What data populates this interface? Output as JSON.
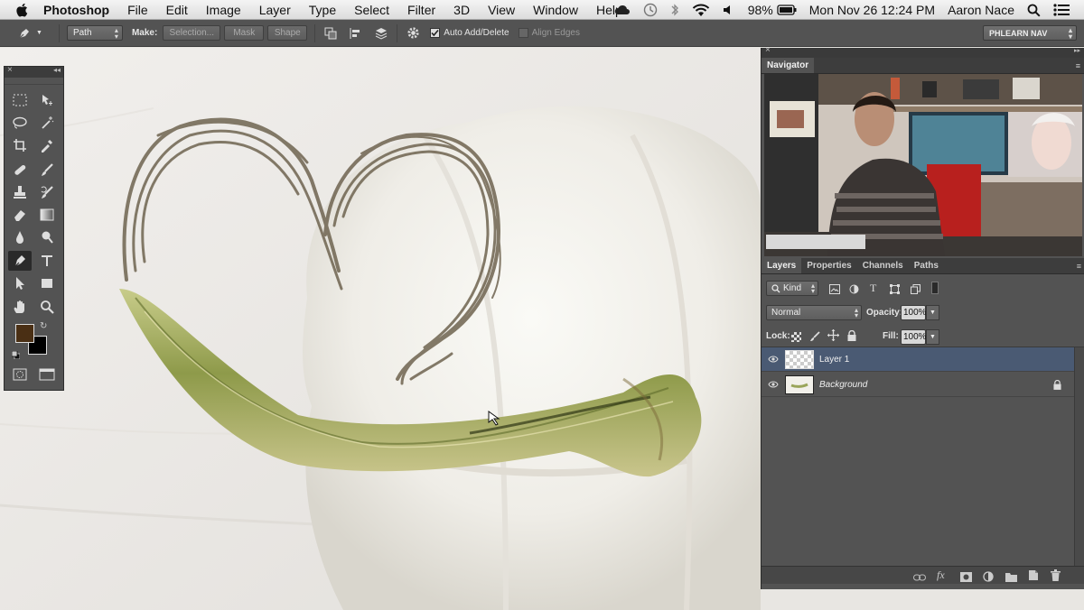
{
  "menubar": {
    "app_name": "Photoshop",
    "items": [
      "File",
      "Edit",
      "Image",
      "Layer",
      "Type",
      "Select",
      "Filter",
      "3D",
      "View",
      "Window",
      "Help"
    ],
    "battery": "98%",
    "clock": "Mon Nov 26  12:24 PM",
    "user": "Aaron Nace"
  },
  "options": {
    "mode": "Path",
    "make_label": "Make:",
    "selection_btn": "Selection...",
    "mask_btn": "Mask",
    "shape_btn": "Shape",
    "auto_add_delete": "Auto Add/Delete",
    "align_edges": "Align Edges",
    "workspace": "PHLEARN NAV"
  },
  "navigator": {
    "title": "Navigator"
  },
  "layers_panel": {
    "tabs": [
      "Layers",
      "Properties",
      "Channels",
      "Paths"
    ],
    "kind": "Kind",
    "blend_mode": "Normal",
    "opacity_label": "Opacity:",
    "opacity": "100%",
    "lock_label": "Lock:",
    "fill_label": "Fill:",
    "fill": "100%",
    "layers": [
      {
        "name": "Layer 1",
        "selected": true
      },
      {
        "name": "Background",
        "locked": true
      }
    ]
  },
  "colors": {
    "foreground": "#4a2f14",
    "background": "#000000",
    "selection": "#4a5a73"
  }
}
